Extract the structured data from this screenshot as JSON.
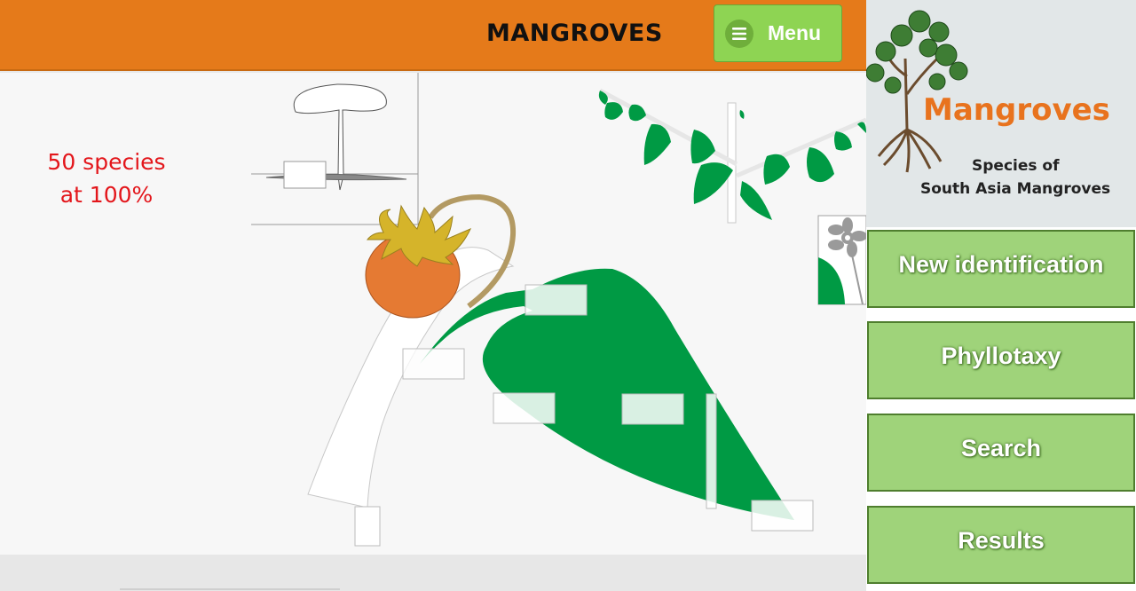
{
  "header": {
    "title": "MANGROVES",
    "menu_label": "Menu"
  },
  "main": {
    "species_count_line1": "50 species",
    "species_count_line2": "at 100%"
  },
  "sidebar": {
    "logo": {
      "title": "Mangroves",
      "subtitle_line1": "Species of",
      "subtitle_line2": "South Asia Mangroves"
    },
    "buttons": [
      {
        "label": "New identification"
      },
      {
        "label": "Phyllotaxy"
      },
      {
        "label": "Search"
      },
      {
        "label": "Results"
      }
    ]
  },
  "colors": {
    "header_bg": "#e57a1a",
    "menu_button": "#8ed453",
    "nav_button": "#9fd37a",
    "leaf_green": "#009a44",
    "species_text": "#e3161b",
    "fruit_orange": "#e57a33"
  },
  "icons": {
    "menu": "hamburger-icon",
    "logo": "mangrove-tree-icon"
  }
}
